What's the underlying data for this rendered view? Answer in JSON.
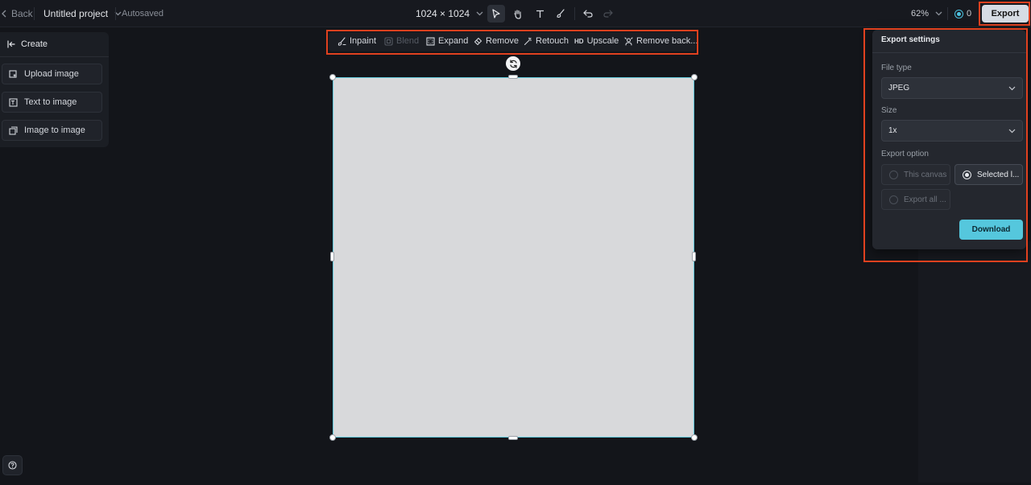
{
  "topbar": {
    "back_label": "Back",
    "project_name": "Untitled project",
    "status": "Autosaved",
    "canvas_size": "1024 × 1024",
    "zoom": "62%",
    "credits": "0",
    "export_label": "Export"
  },
  "left_panel": {
    "title": "Create",
    "items": [
      {
        "label": "Upload image"
      },
      {
        "label": "Text to image"
      },
      {
        "label": "Image to image"
      }
    ]
  },
  "canvas_toolbar": {
    "items": [
      {
        "label": "Inpaint",
        "enabled": true
      },
      {
        "label": "Blend",
        "enabled": false
      },
      {
        "label": "Expand",
        "enabled": true
      },
      {
        "label": "Remove",
        "enabled": true
      },
      {
        "label": "Retouch",
        "enabled": true
      },
      {
        "label": "Upscale",
        "badge": "HD",
        "enabled": true
      },
      {
        "label": "Remove back...",
        "enabled": true
      }
    ]
  },
  "export_settings": {
    "title": "Export settings",
    "file_type_label": "File type",
    "file_type_value": "JPEG",
    "size_label": "Size",
    "size_value": "1x",
    "export_option_label": "Export option",
    "options": [
      {
        "label": "This canvas",
        "selected": false
      },
      {
        "label": "Selected l...",
        "selected": true
      },
      {
        "label": "Export all ...",
        "selected": false
      }
    ],
    "download_label": "Download"
  },
  "colors": {
    "accent": "#55c7dd",
    "highlight": "#e0411f",
    "background": "#13151a"
  }
}
